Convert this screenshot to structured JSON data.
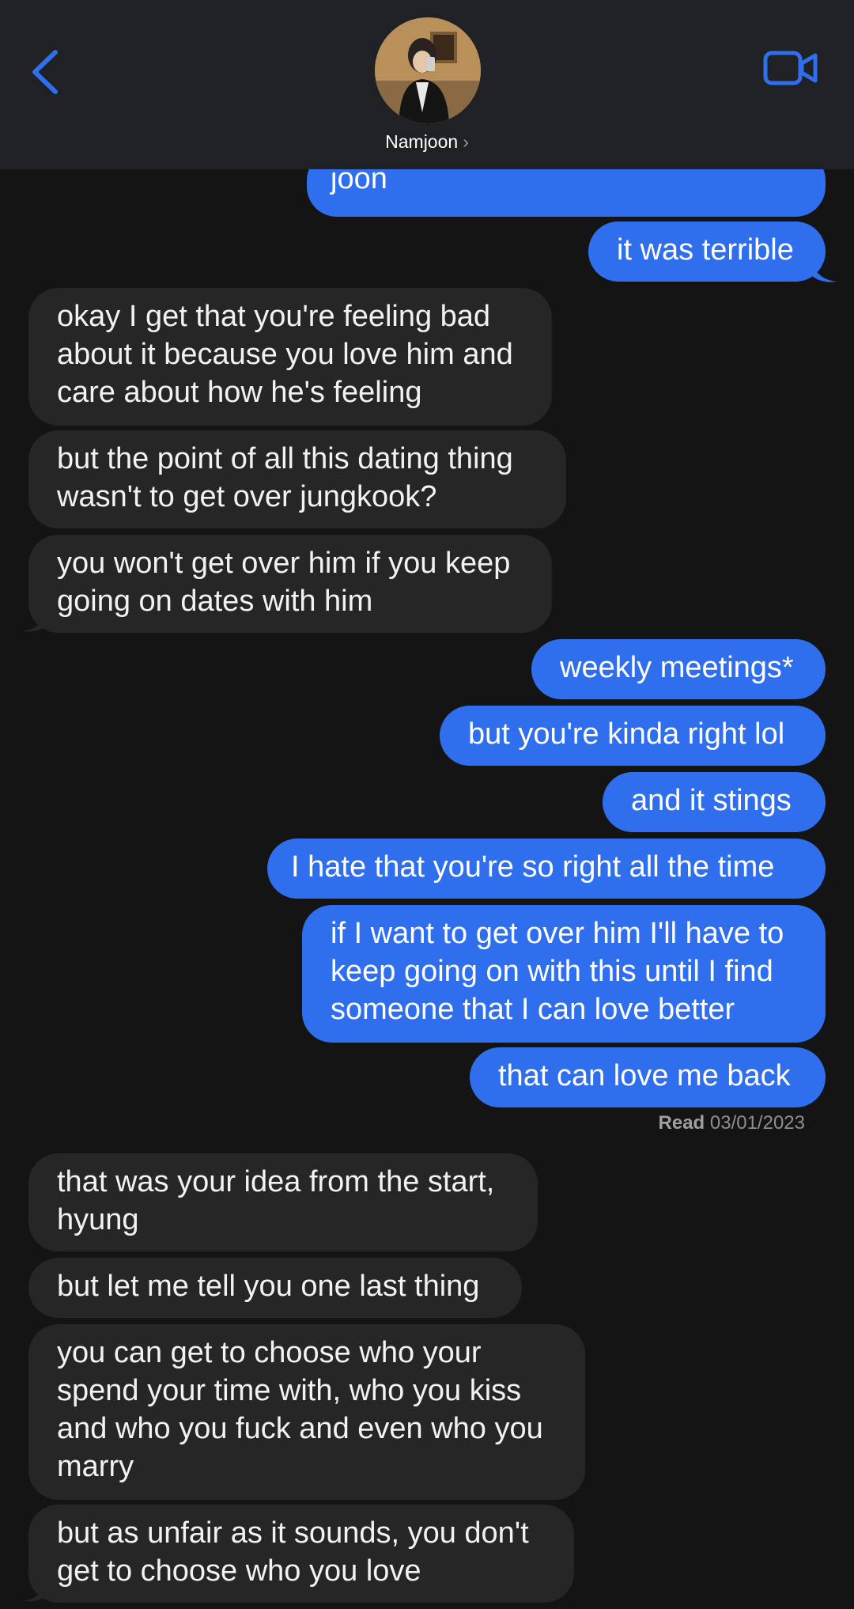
{
  "header": {
    "contact_name": "Namjoon",
    "back_icon": "chevron-left-icon",
    "video_icon": "video-camera-icon",
    "accent": "#2f6fed"
  },
  "messages": [
    {
      "dir": "out",
      "text": "joon"
    },
    {
      "dir": "out",
      "text": "it was terrible"
    },
    {
      "dir": "in",
      "text": "okay I get that you're feeling bad about it because you love him and care about how he's feeling"
    },
    {
      "dir": "in",
      "text": "but the point of all this dating thing wasn't to get over jungkook?"
    },
    {
      "dir": "in",
      "text": "you won't get over him if you keep going on dates with him"
    },
    {
      "dir": "out",
      "text": "weekly meetings*"
    },
    {
      "dir": "out",
      "text": "but you're kinda right lol"
    },
    {
      "dir": "out",
      "text": "and it stings"
    },
    {
      "dir": "out",
      "text": "I hate that you're so right all the time"
    },
    {
      "dir": "out",
      "text": "if I want to get over him I'll have to keep going on with this until I find someone that I can love better"
    },
    {
      "dir": "out",
      "text": "that can love me back"
    },
    {
      "dir": "in",
      "text": "that was your idea from the start, hyung"
    },
    {
      "dir": "in",
      "text": "but let me tell you one last thing"
    },
    {
      "dir": "in",
      "text": "you can get to choose who your spend your time with, who you kiss and who you fuck and even who you marry"
    },
    {
      "dir": "in",
      "text": "but as unfair as it sounds, you don't get to choose who you love"
    }
  ],
  "read_receipt": {
    "label": "Read",
    "date": "03/01/2023"
  },
  "colors": {
    "outgoing": "#2f6fed",
    "incoming": "#262626",
    "background": "#141414",
    "header": "#1f2124"
  }
}
